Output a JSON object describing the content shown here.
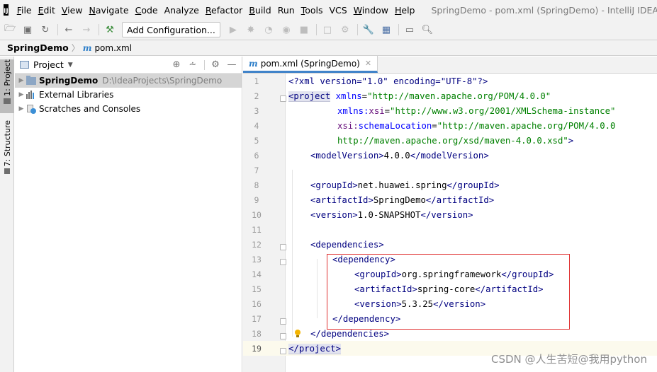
{
  "app": {
    "logo": "IJ",
    "window_title": "SpringDemo - pom.xml (SpringDemo) - IntelliJ IDEA"
  },
  "menu": [
    {
      "label": "File",
      "mnemonic": "F",
      "rest": "ile"
    },
    {
      "label": "Edit",
      "mnemonic": "E",
      "rest": "dit"
    },
    {
      "label": "View",
      "mnemonic": "V",
      "rest": "iew"
    },
    {
      "label": "Navigate",
      "mnemonic": "N",
      "rest": "avigate"
    },
    {
      "label": "Code",
      "mnemonic": "C",
      "rest": "ode"
    },
    {
      "label": "Analyze",
      "mnemonic": "",
      "rest": "Analyze"
    },
    {
      "label": "Refactor",
      "mnemonic": "R",
      "rest": "efactor"
    },
    {
      "label": "Build",
      "mnemonic": "B",
      "rest": "uild"
    },
    {
      "label": "Run",
      "mnemonic": "",
      "rest": "Run"
    },
    {
      "label": "Tools",
      "mnemonic": "T",
      "rest": "ools"
    },
    {
      "label": "VCS",
      "mnemonic": "",
      "rest": "VCS"
    },
    {
      "label": "Window",
      "mnemonic": "W",
      "rest": "indow"
    },
    {
      "label": "Help",
      "mnemonic": "H",
      "rest": "elp"
    }
  ],
  "toolbar": {
    "add_configuration": "Add Configuration...",
    "icons": [
      "open-folder-icon",
      "save-icon",
      "sync-icon",
      "back-icon",
      "forward-icon",
      "build-hammer-icon",
      "run-icon",
      "debug-icon",
      "coverage-icon",
      "profile-icon",
      "stop-icon",
      "search-structure-icon",
      "vcs-icon",
      "settings-wrench-icon",
      "project-structure-icon",
      "terminal-icon",
      "search-icon"
    ]
  },
  "breadcrumb": {
    "project": "SpringDemo",
    "file": "pom.xml"
  },
  "left_strip": {
    "project_tab": "1: Project",
    "structure_tab": "7: Structure"
  },
  "project_panel": {
    "title": "Project",
    "tree": [
      {
        "name": "SpringDemo",
        "path": "D:\\IdeaProjects\\SpringDemo",
        "selected": true
      },
      {
        "name": "External Libraries",
        "path": ""
      },
      {
        "name": "Scratches and Consoles",
        "path": ""
      }
    ]
  },
  "editor": {
    "tab_label": "pom.xml (SpringDemo)",
    "current_line": 19,
    "line_numbers": [
      "1",
      "2",
      "3",
      "4",
      "5",
      "6",
      "7",
      "8",
      "9",
      "10",
      "11",
      "12",
      "13",
      "14",
      "15",
      "16",
      "17",
      "18",
      "19"
    ]
  },
  "code": {
    "l1_pi": "<?xml version=\"1.0\" encoding=\"UTF-8\"?>",
    "project": "project",
    "xmlns": "xmlns",
    "xmlns_val": "\"http://maven.apache.org/POM/4.0.0\"",
    "xmlns_xsi_ns": "xmlns:",
    "xmlns_xsi_attr": "xsi",
    "xmlns_xsi_val": "\"http://www.w3.org/2001/XMLSchema-instance\"",
    "xsi_ns": "xsi:",
    "xsi_attr": "schemaLocation",
    "xsi_val_a": "\"http://maven.apache.org/POM/4.0.0",
    "xsi_val_b": "http://maven.apache.org/xsd/maven-4.0.0.xsd\"",
    "modelVersion": "modelVersion",
    "modelVersion_val": "4.0.0",
    "groupId": "groupId",
    "groupId_val": "net.huawei.spring",
    "artifactId": "artifactId",
    "artifactId_val": "SpringDemo",
    "version": "version",
    "version_val": "1.0-SNAPSHOT",
    "dependencies": "dependencies",
    "dependency": "dependency",
    "dep_groupId_val": "org.springframework",
    "dep_artifactId_val": "spring-core",
    "dep_version_val": "5.3.25"
  },
  "watermark": "CSDN @人生苦短@我用python"
}
